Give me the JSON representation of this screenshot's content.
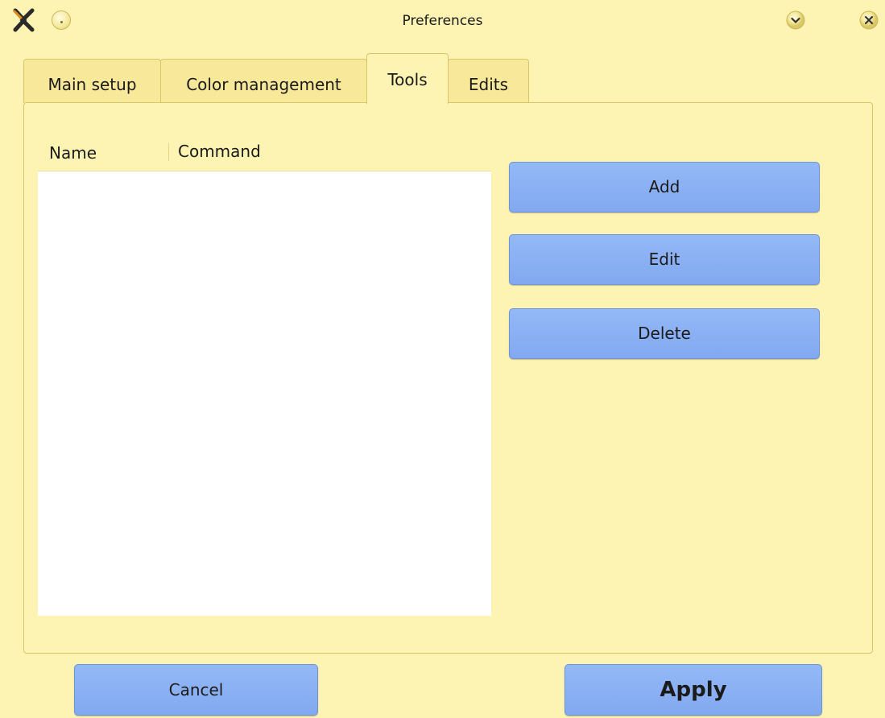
{
  "window": {
    "title": "Preferences",
    "icons": {
      "app": "app-icon",
      "minimize": "minimize-icon",
      "shade": "chevron-down-icon",
      "close": "close-icon"
    }
  },
  "tabs": [
    {
      "label": "Main setup",
      "active": false
    },
    {
      "label": "Color management",
      "active": false
    },
    {
      "label": "Tools",
      "active": true
    },
    {
      "label": "Edits",
      "active": false
    }
  ],
  "tools_list": {
    "columns": [
      "Name",
      "Command"
    ],
    "rows": []
  },
  "side_buttons": {
    "add": "Add",
    "edit": "Edit",
    "delete": "Delete"
  },
  "footer": {
    "cancel": "Cancel",
    "apply": "Apply"
  },
  "colors": {
    "window_bg": "#fdf3b3",
    "button_blue": "#8db3f5",
    "list_bg": "#ffffff"
  }
}
